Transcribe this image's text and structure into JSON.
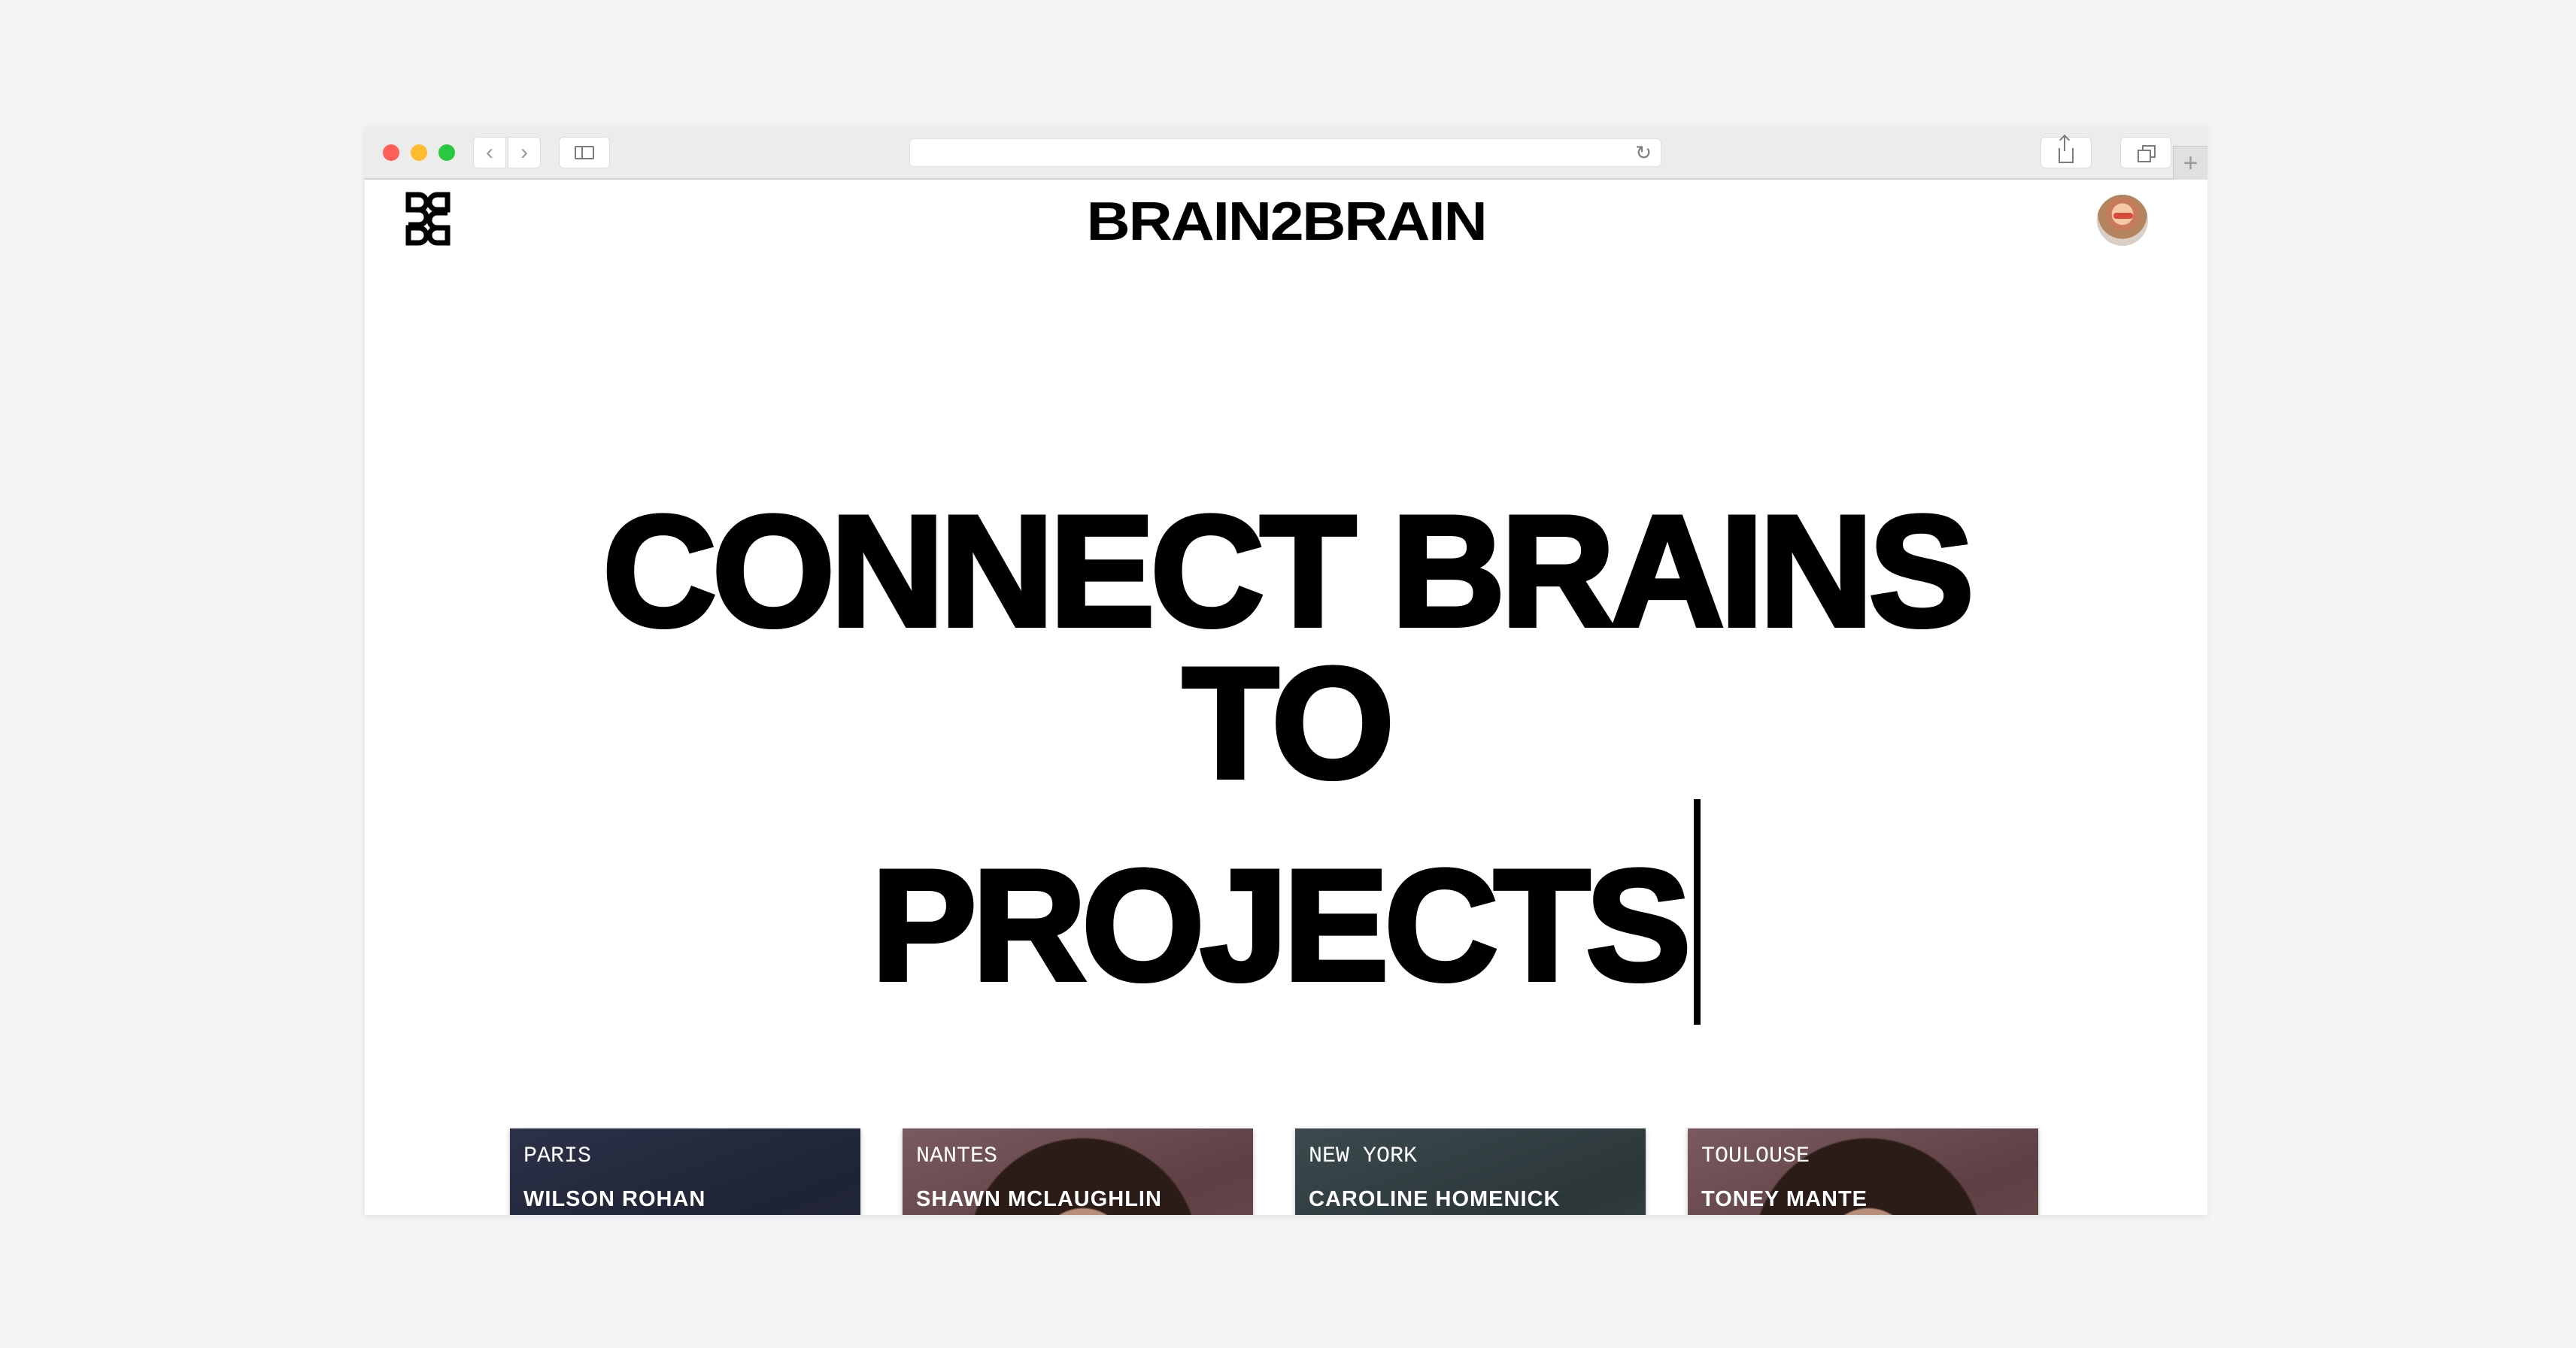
{
  "brand": {
    "name": "BRAIN2BRAIN"
  },
  "hero": {
    "lines": [
      "CONNECT BRAINS",
      "TO",
      "PROJECTS"
    ]
  },
  "cards": [
    {
      "city": "PARIS",
      "name": "WILSON ROHAN"
    },
    {
      "city": "NANTES",
      "name": "SHAWN MCLAUGHLIN"
    },
    {
      "city": "NEW YORK",
      "name": "CAROLINE HOMENICK"
    },
    {
      "city": "TOULOUSE",
      "name": "TONEY MANTE"
    }
  ],
  "browser": {
    "back_icon": "chevron-left-icon",
    "forward_icon": "chevron-right-icon",
    "reload_icon": "reload-icon",
    "share_icon": "share-icon",
    "tabs_icon": "tabs-icon",
    "newtab_icon": "plus-icon"
  },
  "colors": {
    "background": "#f4f4f6",
    "page": "#ffffff",
    "text": "#000000",
    "traffic_red": "#fe5f57",
    "traffic_yellow": "#febc2e",
    "traffic_green": "#28c840"
  }
}
